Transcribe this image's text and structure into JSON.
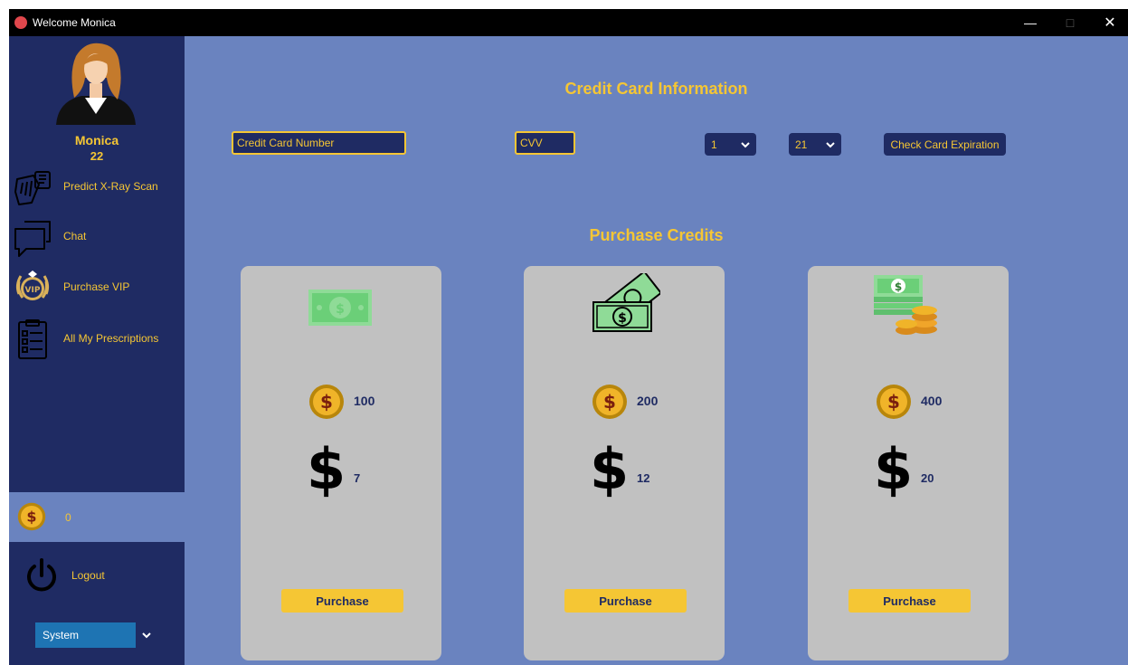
{
  "window": {
    "title": "Welcome Monica",
    "minimize_glyph": "—",
    "maximize_glyph": "□",
    "close_glyph": "✕"
  },
  "user": {
    "name": "Monica",
    "age": "22"
  },
  "sidebar": {
    "items": [
      {
        "label": "Predict X-Ray Scan",
        "icon": "hand-xray-icon"
      },
      {
        "label": "Chat",
        "icon": "chat-bubble-icon"
      },
      {
        "label": "Purchase VIP",
        "icon": "vip-badge-icon",
        "badge_text": "VIP"
      },
      {
        "label": "All My Prescriptions",
        "icon": "clipboard-list-icon"
      }
    ],
    "credits": "0",
    "logout_label": "Logout",
    "theme_value": "System"
  },
  "credit_card": {
    "title": "Credit Card Information",
    "number_placeholder": "Credit Card Number",
    "cvv_placeholder": "CVV",
    "month_value": "1",
    "separator": "/",
    "year_value": "21",
    "check_label": "Check Card Expiration"
  },
  "purchase": {
    "title": "Purchase Credits",
    "packages": [
      {
        "coins": "100",
        "price": "7",
        "image": "single-banknote-icon",
        "button_label": "Purchase"
      },
      {
        "coins": "200",
        "price": "12",
        "image": "banknote-stack-icon",
        "button_label": "Purchase"
      },
      {
        "coins": "400",
        "price": "20",
        "image": "cash-and-coins-icon",
        "button_label": "Purchase"
      }
    ],
    "dollar_glyph": "$"
  },
  "colors": {
    "sidebar_bg": "#1f2b63",
    "main_bg": "#6a83bf",
    "accent": "#f5c634",
    "card_bg": "#c1c1c1",
    "theme_select": "#1e74b3"
  }
}
